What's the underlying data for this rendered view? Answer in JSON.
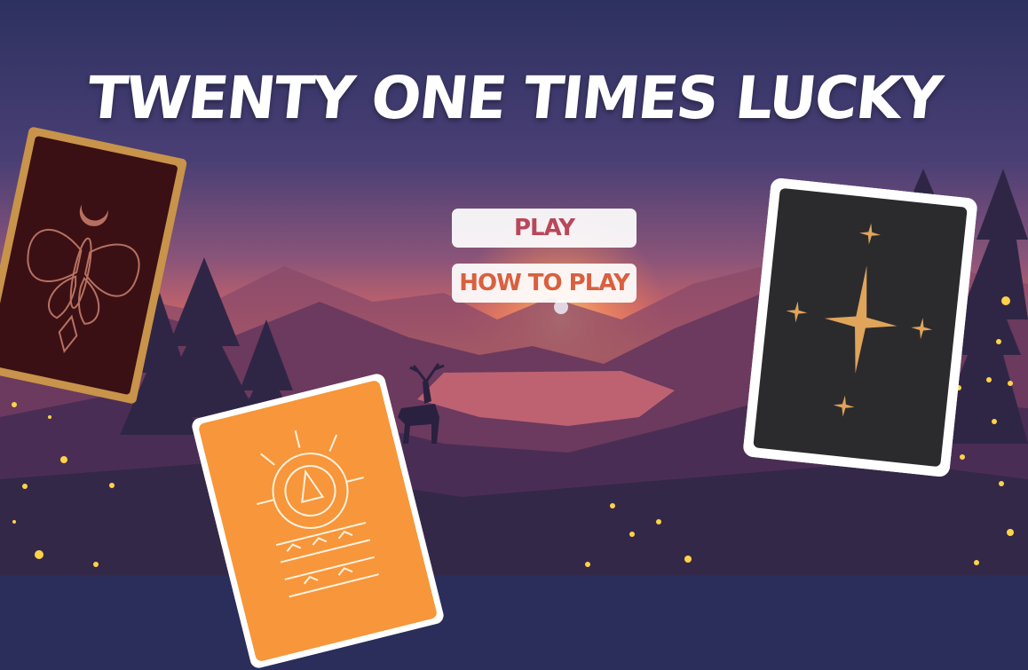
{
  "game": {
    "title": "TWENTY ONE TIMES LUCKY"
  },
  "menu": {
    "play_label": "PLAY",
    "how_to_play_label": "HOW TO PLAY"
  },
  "cards": [
    {
      "name": "moth-card",
      "face": "moth-and-moon",
      "color": "#3a1014"
    },
    {
      "name": "orange-card",
      "face": "sun-ornament",
      "color": "#f7963a"
    },
    {
      "name": "star-card",
      "face": "four-sparkles",
      "color": "#2b2b2e"
    }
  ],
  "colors": {
    "sky_top": "#2d3160",
    "sunset": "#f07a4c",
    "play_text": "#b9475a",
    "how_text": "#d9603f",
    "firefly": "#ffd24a"
  }
}
